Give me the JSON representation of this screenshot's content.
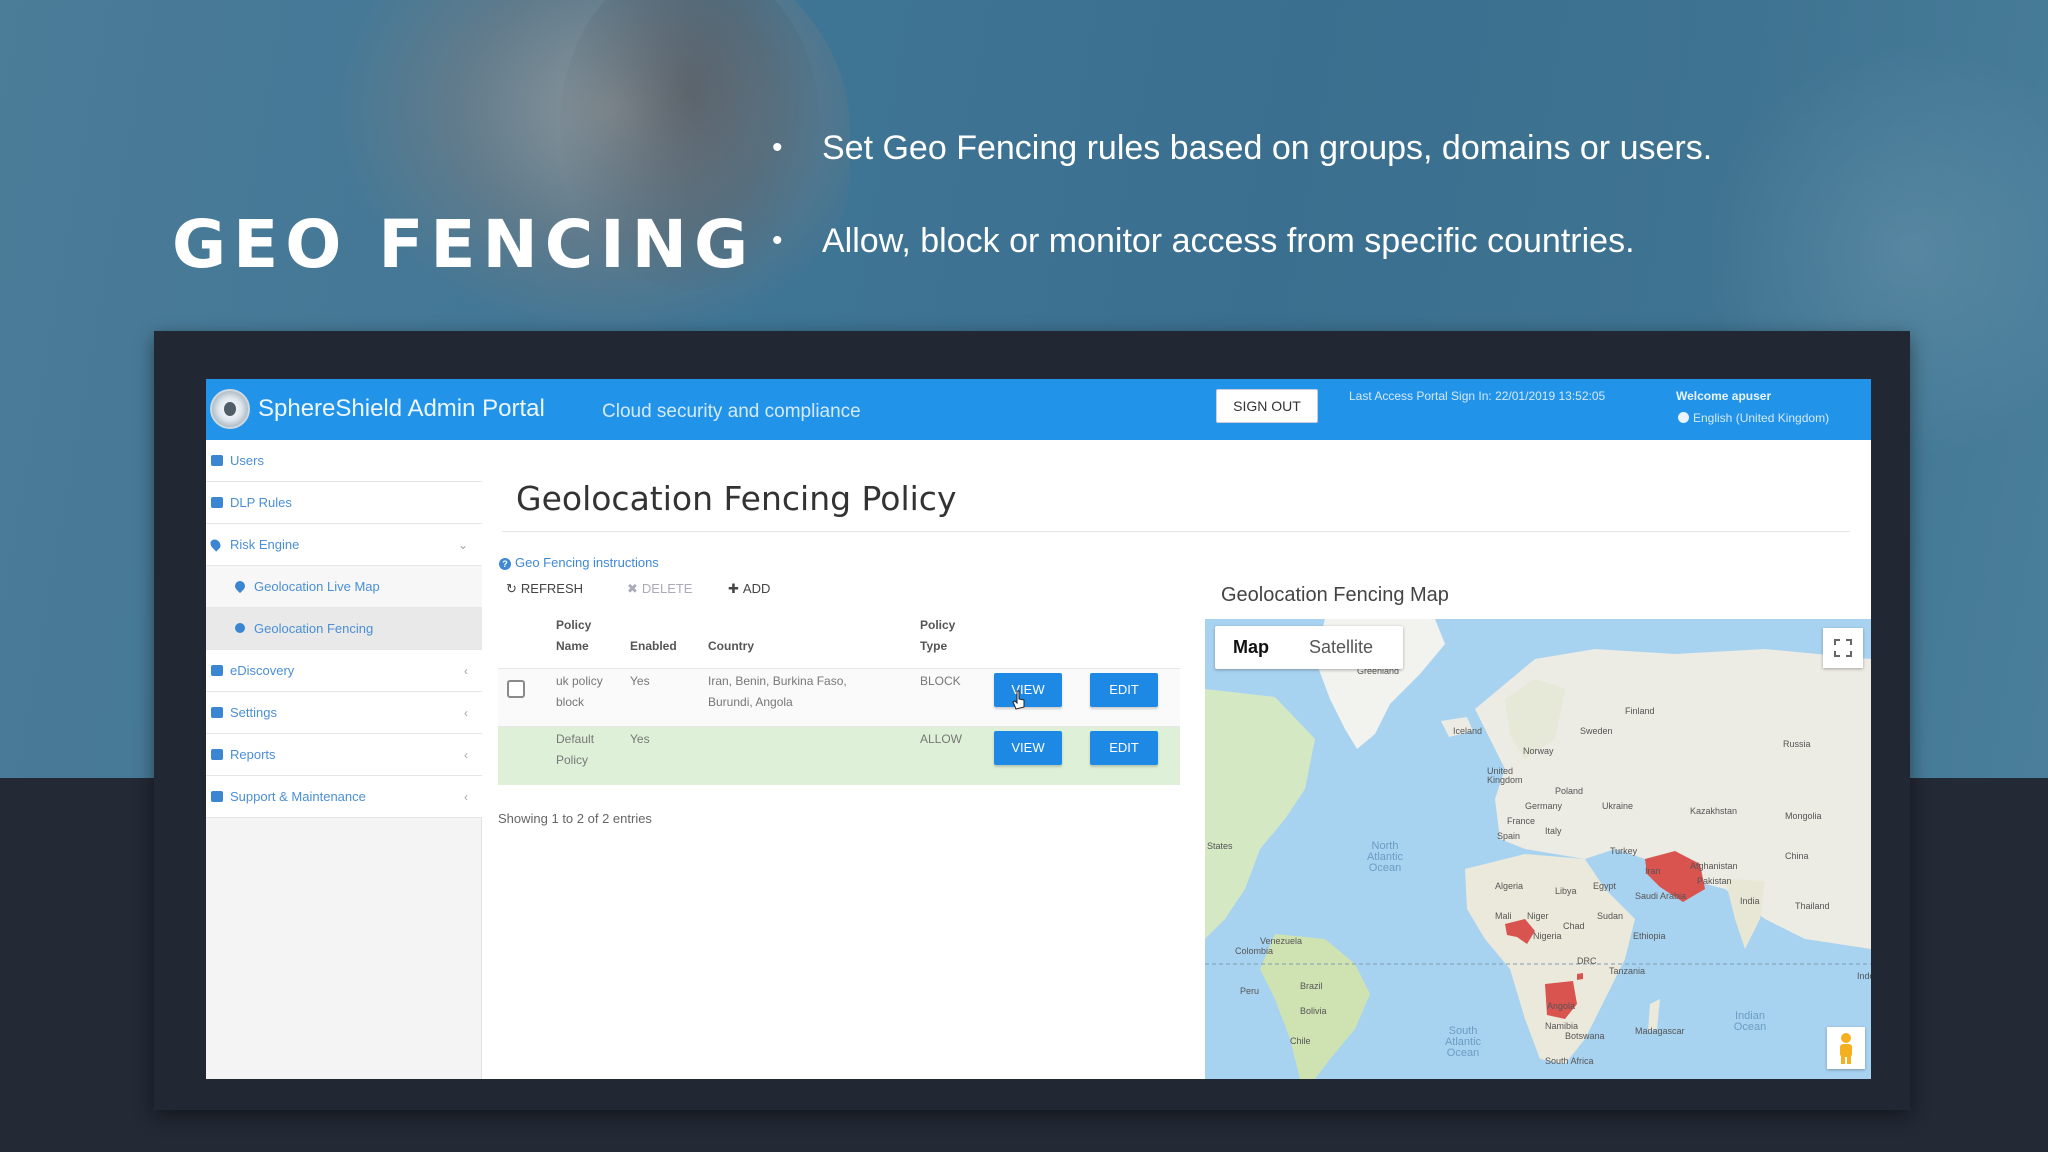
{
  "slide": {
    "title": "GEO FENCING",
    "bullets": [
      "Set Geo Fencing rules based on groups, domains or users.",
      "Allow, block or monitor access from specific countries."
    ]
  },
  "header": {
    "app_title": "SphereShield Admin Portal",
    "tagline": "Cloud security and compliance",
    "sign_out": "SIGN OUT",
    "last_access": "Last Access Portal Sign In: 22/01/2019 13:52:05",
    "welcome": "Welcome apuser",
    "language": "English (United Kingdom)"
  },
  "sidebar": {
    "items": [
      {
        "label": "Users",
        "icon": "users-icon"
      },
      {
        "label": "DLP Rules",
        "icon": "eye-icon"
      },
      {
        "label": "Risk Engine",
        "icon": "map-marker-icon",
        "chevron": "⌄"
      },
      {
        "label": "Geolocation Live Map",
        "icon": "map-marker-icon"
      },
      {
        "label": "Geolocation Fencing",
        "icon": "globe-icon"
      },
      {
        "label": "eDiscovery",
        "icon": "book-icon",
        "chevron": "‹"
      },
      {
        "label": "Settings",
        "icon": "cogs-icon",
        "chevron": "‹"
      },
      {
        "label": "Reports",
        "icon": "bar-chart-icon",
        "chevron": "‹"
      },
      {
        "label": "Support & Maintenance",
        "icon": "list-icon",
        "chevron": "‹"
      }
    ]
  },
  "main": {
    "title": "Geolocation Fencing Policy",
    "instructions_link": "Geo Fencing instructions",
    "toolbar": {
      "refresh": "REFRESH",
      "delete": "DELETE",
      "add": "ADD"
    },
    "table": {
      "headers": {
        "policy_name": [
          "Policy",
          "Name"
        ],
        "enabled": "Enabled",
        "country": "Country",
        "policy_type": [
          "Policy",
          "Type"
        ]
      },
      "rows": [
        {
          "name": [
            "uk policy",
            "block"
          ],
          "enabled": "Yes",
          "country": [
            "Iran, Benin, Burkina Faso,",
            "Burundi, Angola"
          ],
          "type": "BLOCK",
          "view": "VIEW",
          "edit": "EDIT"
        },
        {
          "name": [
            "Default",
            "Policy"
          ],
          "enabled": "Yes",
          "country": [
            "",
            ""
          ],
          "type": "ALLOW",
          "view": "VIEW",
          "edit": "EDIT"
        }
      ]
    },
    "showing": "Showing 1 to 2 of 2 entries"
  },
  "map": {
    "title": "Geolocation Fencing Map",
    "tab_map": "Map",
    "tab_satellite": "Satellite",
    "blocked_color": "#d9534f",
    "labels": [
      "Greenland",
      "Iceland",
      "Sweden",
      "Finland",
      "Norway",
      "Russia",
      "United Kingdom",
      "Poland",
      "Germany",
      "Ukraine",
      "Kazakhstan",
      "Mongolia",
      "France",
      "Spain",
      "Italy",
      "Turkey",
      "China",
      "Iran",
      "Afghanistan",
      "Pakistan",
      "India",
      "Thailand",
      "Algeria",
      "Libya",
      "Egypt",
      "Saudi Arabia",
      "Mali",
      "Niger",
      "Chad",
      "Sudan",
      "Nigeria",
      "Ethiopia",
      "DRC",
      "Tanzania",
      "Angola",
      "Namibia",
      "Botswana",
      "Madagascar",
      "South Africa",
      "Venezuela",
      "Colombia",
      "Peru",
      "Brazil",
      "Bolivia",
      "Chile",
      "States",
      "Indo"
    ],
    "oceans": [
      "North Atlantic Ocean",
      "South Atlantic Ocean",
      "Indian Ocean"
    ]
  }
}
